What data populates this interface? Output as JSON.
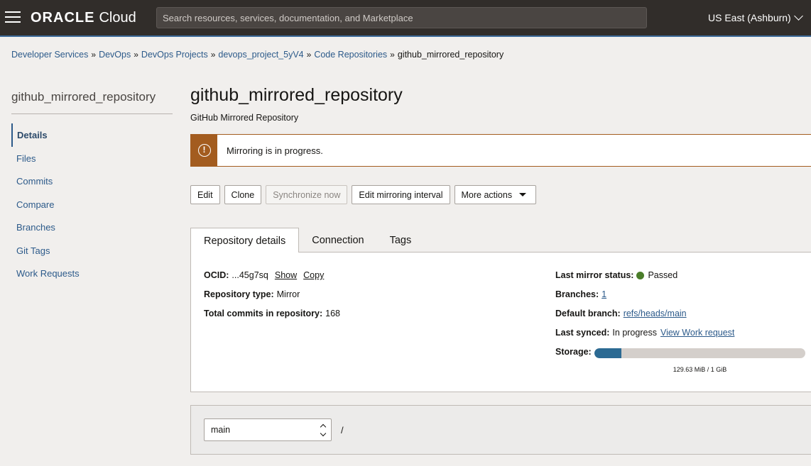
{
  "header": {
    "logo_brand": "ORACLE",
    "logo_product": "Cloud",
    "search_placeholder": "Search resources, services, documentation, and Marketplace",
    "region": "US East (Ashburn)"
  },
  "breadcrumb": {
    "items": [
      "Developer Services",
      "DevOps",
      "DevOps Projects",
      "devops_project_5yV4",
      "Code Repositories"
    ],
    "current": "github_mirrored_repository",
    "separator": "»"
  },
  "sidebar": {
    "title": "github_mirrored_repository",
    "items": [
      {
        "label": "Details",
        "active": true
      },
      {
        "label": "Files"
      },
      {
        "label": "Commits"
      },
      {
        "label": "Compare"
      },
      {
        "label": "Branches"
      },
      {
        "label": "Git Tags"
      },
      {
        "label": "Work Requests"
      }
    ]
  },
  "main": {
    "title": "github_mirrored_repository",
    "subtitle": "GitHub Mirrored Repository",
    "banner": {
      "text": "Mirroring is in progress.",
      "icon": "warning-icon",
      "color": "#a35c1f"
    },
    "actions": {
      "edit": "Edit",
      "clone": "Clone",
      "synchronize": "Synchronize now",
      "edit_interval": "Edit mirroring interval",
      "more": "More actions"
    },
    "tabs": [
      "Repository details",
      "Connection",
      "Tags"
    ],
    "details": {
      "ocid_label": "OCID:",
      "ocid_value": "...45g7sq",
      "show": "Show",
      "copy": "Copy",
      "repo_type_label": "Repository type:",
      "repo_type_value": "Mirror",
      "commits_label": "Total commits in repository:",
      "commits_value": "168",
      "mirror_status_label": "Last mirror status:",
      "mirror_status_value": "Passed",
      "mirror_status_color": "#4a7d2a",
      "branches_label": "Branches:",
      "branches_value": "1",
      "default_branch_label": "Default branch:",
      "default_branch_value": "refs/heads/main",
      "last_synced_label": "Last synced:",
      "last_synced_value": "In progress",
      "view_work_request": "View Work request",
      "storage_label": "Storage:",
      "storage_text": "129.63 MiB / 1 GiB",
      "storage_fraction": 0.127
    },
    "branch_select": {
      "value": "main",
      "path": "/"
    }
  }
}
